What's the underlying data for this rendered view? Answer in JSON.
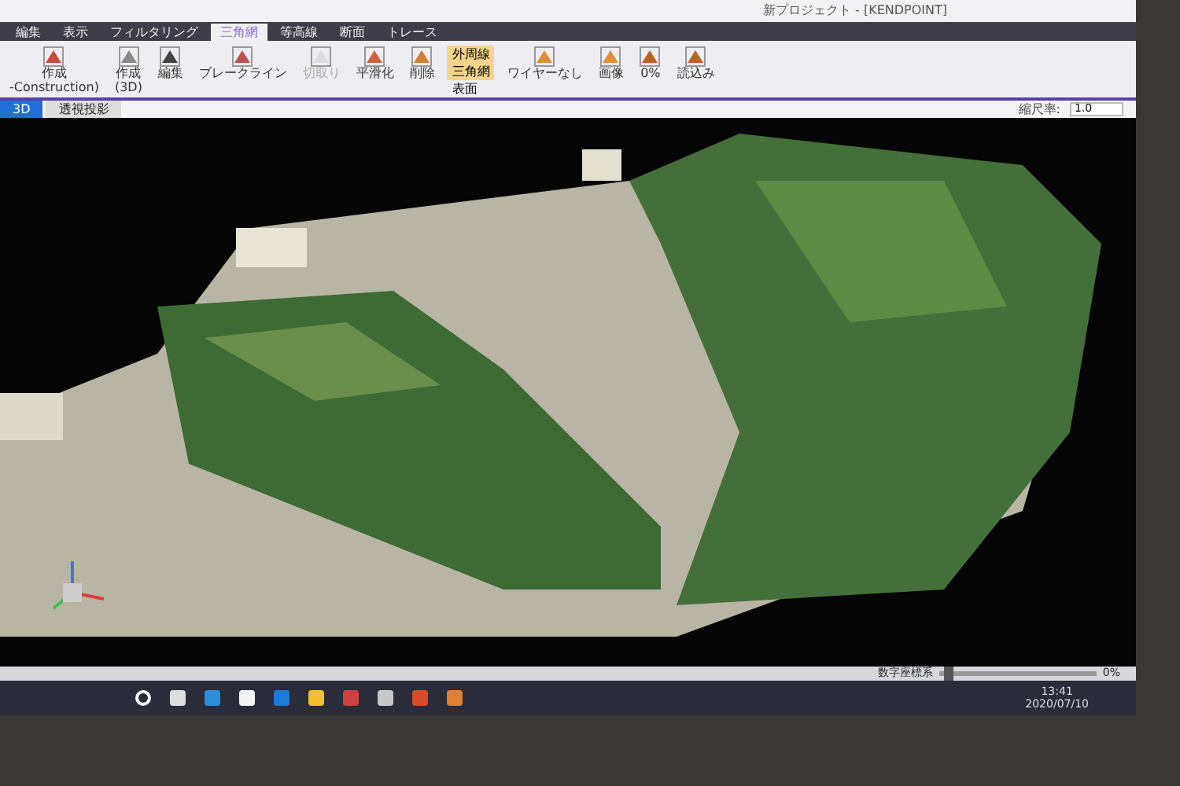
{
  "window": {
    "title": "新プロジェクト - [KENDPOINT]"
  },
  "ribbon_tabs": [
    {
      "label": "編集",
      "selected": false
    },
    {
      "label": "表示",
      "selected": false
    },
    {
      "label": "フィルタリング",
      "selected": false
    },
    {
      "label": "三角網",
      "selected": true
    },
    {
      "label": "等高線",
      "selected": false
    },
    {
      "label": "断面",
      "selected": false
    },
    {
      "label": "トレース",
      "selected": false
    }
  ],
  "ribbon_buttons": [
    {
      "label": "作成",
      "sub": "-Construction)",
      "disabled": false
    },
    {
      "label": "作成",
      "sub": "(3D)",
      "disabled": false
    },
    {
      "label": "編集",
      "disabled": false
    },
    {
      "label": "ブレークライン",
      "disabled": false
    },
    {
      "label": "切取り",
      "disabled": true
    },
    {
      "label": "平滑化",
      "disabled": false
    },
    {
      "label": "削除",
      "disabled": false
    }
  ],
  "display_toggles": [
    {
      "label": "外周線",
      "on": true
    },
    {
      "label": "三角網",
      "on": true
    },
    {
      "label": "表面",
      "on": false
    }
  ],
  "display_buttons": [
    {
      "label": "ワイヤーなし"
    },
    {
      "label": "画像"
    }
  ],
  "opacity_button": {
    "label": "0%"
  },
  "import_button": {
    "label": "読込み"
  },
  "view_tabs": [
    {
      "label": "3D",
      "selected": true
    },
    {
      "label": "透視投影",
      "selected": false
    }
  ],
  "scale": {
    "label": "縮尺率:",
    "value": "1.0"
  },
  "status_bar": {
    "coordinate_system": "数字座標系",
    "zoom": "0%",
    "level": 0.03
  },
  "taskbar": {
    "time": "13:41",
    "date": "2020/07/10"
  }
}
